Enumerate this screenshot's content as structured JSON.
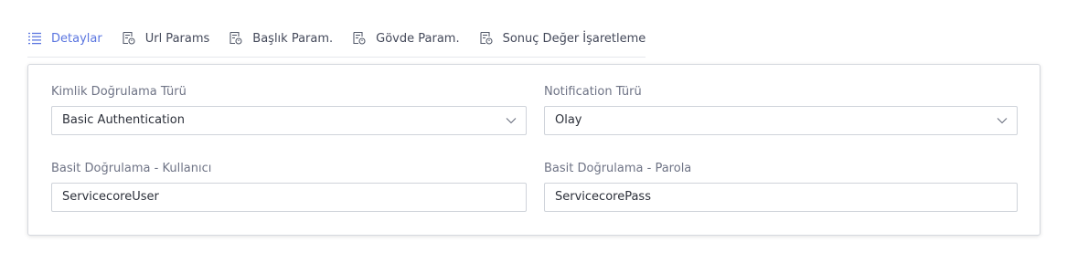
{
  "tabs": [
    {
      "label": "Detaylar",
      "active": true,
      "icon": "list-icon"
    },
    {
      "label": "Url Params",
      "active": false,
      "icon": "params-icon"
    },
    {
      "label": "Başlık Param.",
      "active": false,
      "icon": "params-icon"
    },
    {
      "label": "Gövde Param.",
      "active": false,
      "icon": "params-icon"
    },
    {
      "label": "Sonuç Değer İşaretleme",
      "active": false,
      "icon": "params-icon"
    }
  ],
  "form": {
    "auth_type": {
      "label": "Kimlik Doğrulama Türü",
      "value": "Basic Authentication"
    },
    "notification_type": {
      "label": "Notification Türü",
      "value": "Olay"
    },
    "basic_user": {
      "label": "Basit Doğrulama - Kullanıcı",
      "value": "ServicecoreUser"
    },
    "basic_pass": {
      "label": "Basit Doğrulama - Parola",
      "value": "ServicecorePass"
    }
  },
  "colors": {
    "accent": "#5b76e0",
    "border": "#cfd3da",
    "label": "#6e7385"
  }
}
